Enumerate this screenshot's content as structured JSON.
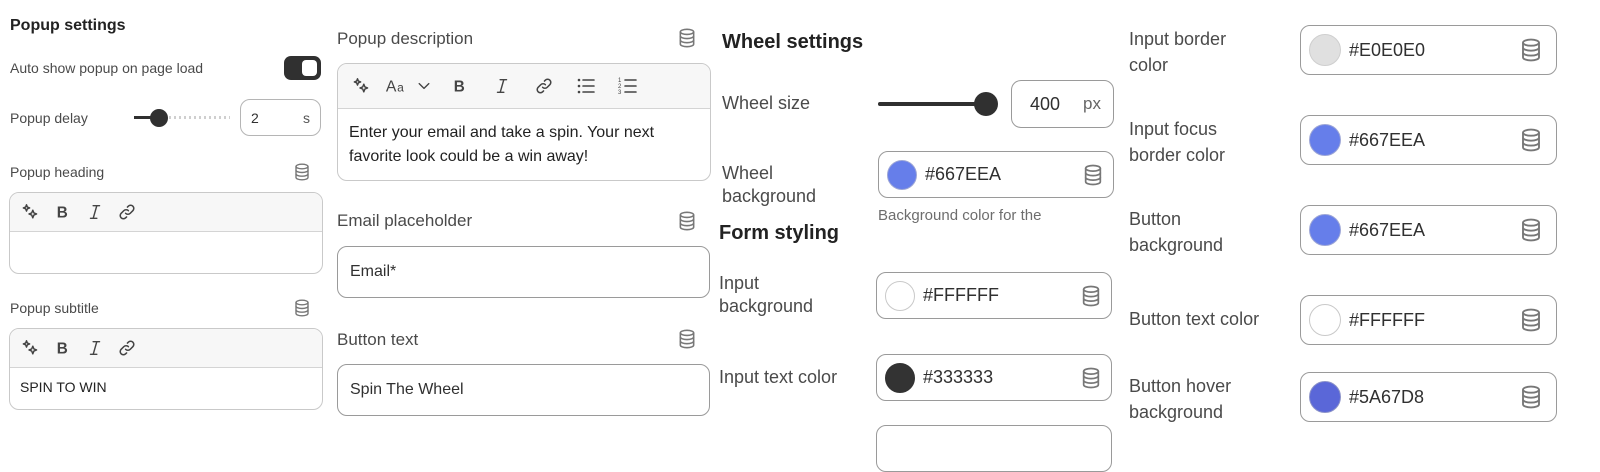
{
  "popup": {
    "section_title": "Popup settings",
    "auto_show_label": "Auto show popup on page load",
    "auto_show_on": true,
    "delay_label": "Popup delay",
    "delay_value": "2",
    "delay_unit": "s",
    "delay_slider_fraction": 0.2,
    "heading_label": "Popup heading",
    "heading_value": "",
    "subtitle_label": "Popup subtitle",
    "subtitle_value": "SPIN TO WIN"
  },
  "content": {
    "description_label": "Popup description",
    "description_value": "Enter your email and take a spin. Your next favorite look could be a win away!",
    "email_placeholder_label": "Email placeholder",
    "email_placeholder_value": "Email*",
    "button_text_label": "Button text",
    "button_text_value": "Spin The Wheel"
  },
  "wheel": {
    "section_title": "Wheel settings",
    "size_label": "Wheel size",
    "size_value": "400",
    "size_unit": "px",
    "size_slider_fraction": 1.0,
    "background_label": "Wheel background",
    "background_value": "#667EEA",
    "background_help": "Background color for the"
  },
  "form": {
    "section_title": "Form styling",
    "input_bg_label": "Input background",
    "input_bg_value": "#FFFFFF",
    "input_text_label": "Input text color",
    "input_text_value": "#333333"
  },
  "colors": {
    "border_label": "Input border color",
    "border_value": "#E0E0E0",
    "focus_label": "Input focus border color",
    "focus_value": "#667EEA",
    "button_bg_label": "Button background",
    "button_bg_value": "#667EEA",
    "button_text_label": "Button text color",
    "button_text_value": "#FFFFFF",
    "button_hover_label": "Button hover background",
    "button_hover_value": "#5A67D8"
  },
  "swatches": {
    "E0E0E0": "#E0E0E0",
    "667EEA": "#667EEA",
    "FFFFFF": "#FFFFFF",
    "333333": "#333333",
    "5A67D8": "#5A67D8"
  },
  "icons": {
    "database": "database-icon",
    "magic": "magic-icon",
    "font": "font-size-icon",
    "bold": "bold-icon",
    "italic": "italic-icon",
    "link": "link-icon",
    "bullets": "bullet-list-icon",
    "numbers": "numbered-list-icon",
    "chevron": "chevron-down-icon"
  }
}
